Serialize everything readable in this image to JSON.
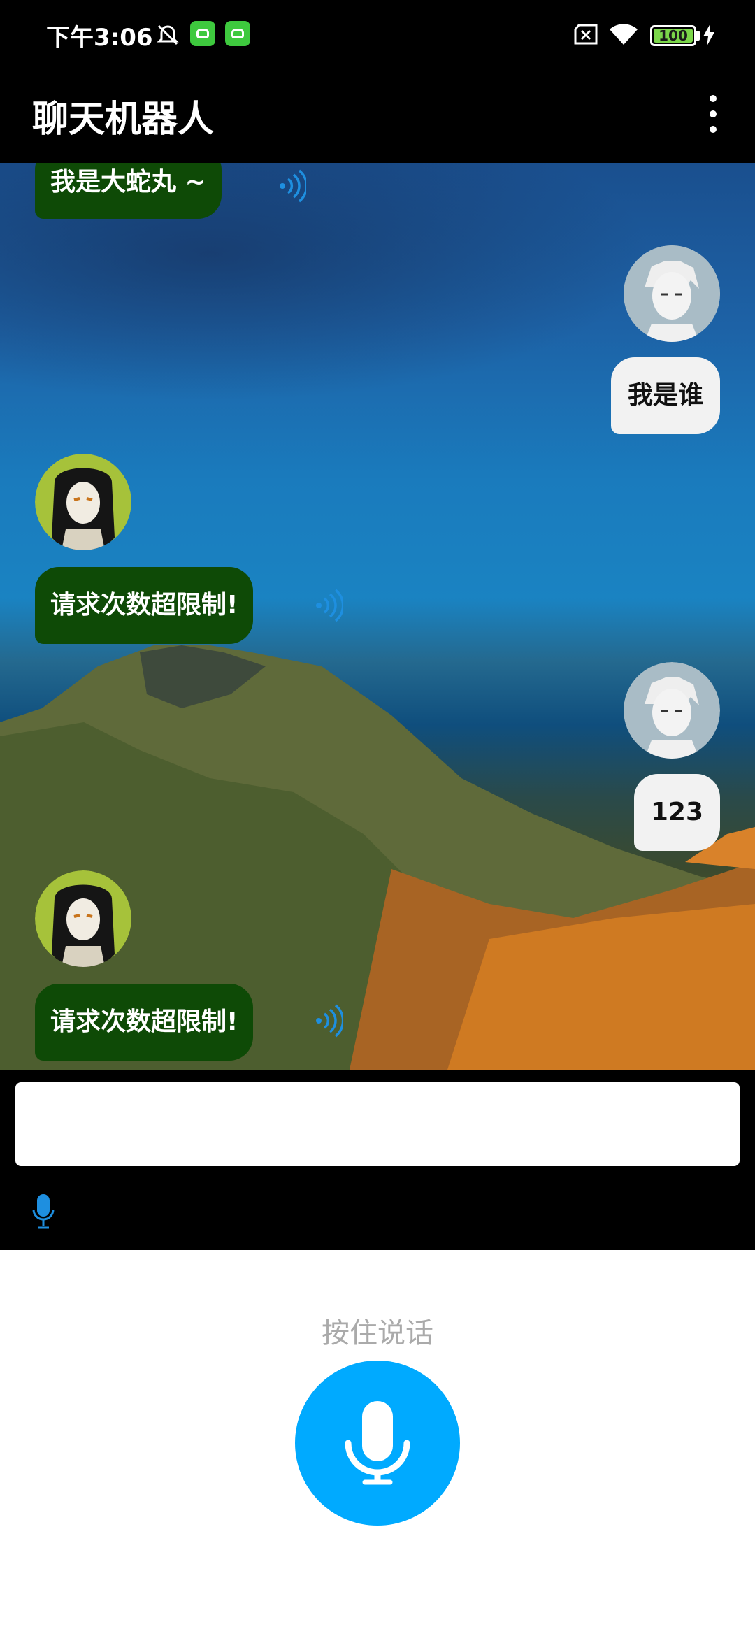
{
  "status_bar": {
    "time": "下午3:06",
    "battery": "100"
  },
  "app_bar": {
    "title": "聊天机器人"
  },
  "messages": [
    {
      "sender": "bot",
      "text": "我是大蛇丸 ~"
    },
    {
      "sender": "user",
      "text": "我是谁"
    },
    {
      "sender": "bot",
      "text": "请求次数超限制!"
    },
    {
      "sender": "user",
      "text": "123"
    },
    {
      "sender": "bot",
      "text": "请求次数超限制!"
    }
  ],
  "input": {
    "value": "",
    "placeholder": ""
  },
  "voice_panel": {
    "hold_to_talk": "按住说话"
  },
  "colors": {
    "bot_bubble": "#0e4a06",
    "user_bubble": "#f2f2f2",
    "mic_button": "#00aaff",
    "speaker_icon": "#1e8fe0"
  }
}
